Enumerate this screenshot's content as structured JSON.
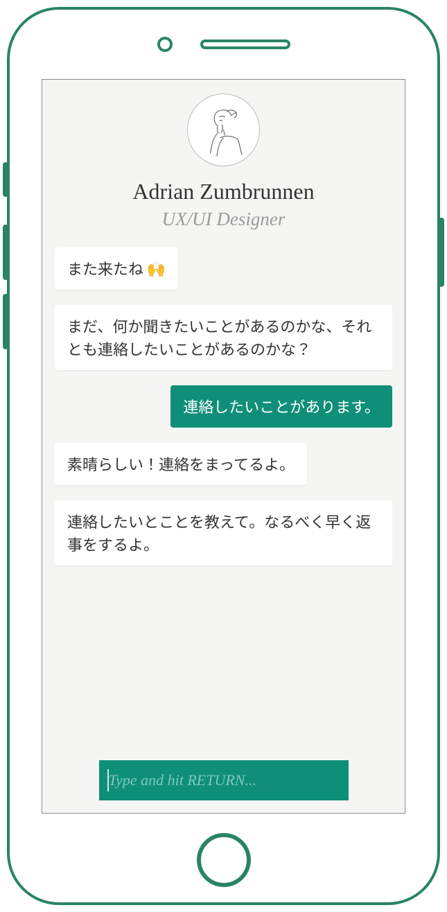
{
  "profile": {
    "name": "Adrian Zumbrunnen",
    "title": "UX/UI Designer"
  },
  "messages": [
    {
      "role": "bot",
      "text": "また来たね 🙌"
    },
    {
      "role": "bot",
      "text": "まだ、何か聞きたいことがあるのかな、それとも連絡したいことがあるのかな？"
    },
    {
      "role": "user",
      "text": "連絡したいことがあります。"
    },
    {
      "role": "bot",
      "text": "素晴らしい！連絡をまってるよ。"
    },
    {
      "role": "bot",
      "text": "連絡したいとことを教えて。なるべく早く返事をするよ。"
    }
  ],
  "input": {
    "placeholder": "Type and hit RETURN...",
    "value": ""
  },
  "colors": {
    "accent": "#0f8f77",
    "frame": "#2a8367",
    "screen_bg": "#f5f6f4"
  }
}
